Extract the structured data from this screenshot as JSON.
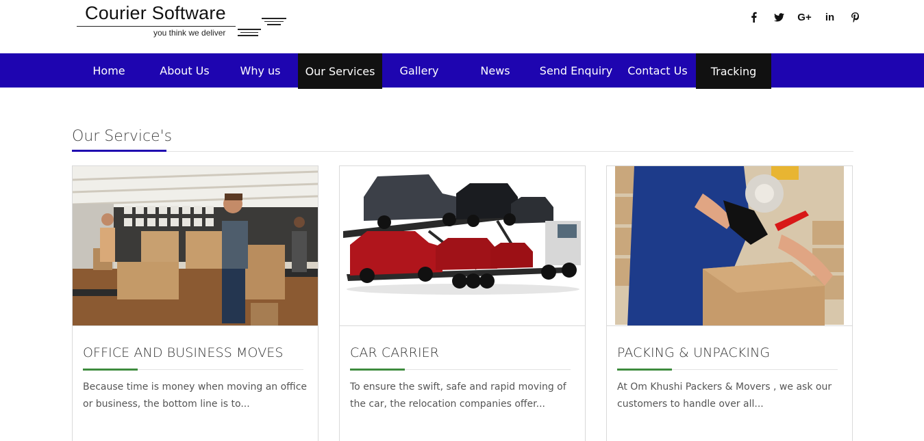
{
  "logo": {
    "title": "Courier Software",
    "tagline": "you think we deliver"
  },
  "social": [
    {
      "icon": "facebook-icon",
      "glyph": "f"
    },
    {
      "icon": "twitter-icon",
      "glyph": "🐦"
    },
    {
      "icon": "google-plus-icon",
      "glyph": "G+"
    },
    {
      "icon": "linkedin-icon",
      "glyph": "in"
    },
    {
      "icon": "pinterest-icon",
      "glyph": "P"
    }
  ],
  "nav": {
    "items": [
      {
        "label": "Home"
      },
      {
        "label": "About Us"
      },
      {
        "label": "Why us"
      },
      {
        "label": "Our Services",
        "active": true
      },
      {
        "label": "Gallery"
      },
      {
        "label": "News"
      },
      {
        "label": "Send Enquiry"
      },
      {
        "label": "Contact Us"
      },
      {
        "label": "Tracking",
        "active": true
      }
    ],
    "bg_color": "#1e05b0",
    "active_color": "#111111"
  },
  "section": {
    "title": "Our Service's"
  },
  "cards": [
    {
      "title": "OFFICE AND BUSINESS MOVES",
      "text": "Because time is money when moving an office or business, the bottom line is to...",
      "image": "office-moving-photo"
    },
    {
      "title": "CAR CARRIER",
      "text": "To ensure the swift, safe and rapid moving of the car, the relocation companies offer...",
      "image": "car-carrier-truck-photo"
    },
    {
      "title": "PACKING & UNPACKING",
      "text": "At Om Khushi Packers & Movers , we ask our customers to handle over all...",
      "image": "packing-tape-photo"
    }
  ],
  "colors": {
    "accent_green": "#3d8b3d",
    "brand_blue": "#1e05b0"
  }
}
